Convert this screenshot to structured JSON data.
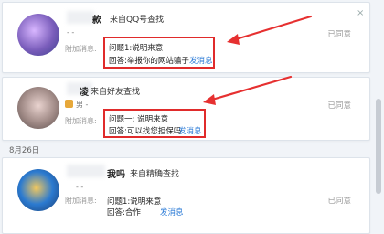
{
  "requests": [
    {
      "name_suffix": "款",
      "source": "来自QQ号查找",
      "meta_line": "- -",
      "attach_label": "附加消息:",
      "question": "问题1:说明来意",
      "answer": "回答:举报你的网站骗子",
      "reply_link": "发消息",
      "status": "已同意"
    },
    {
      "name_suffix": "凌",
      "source": "来自好友查找",
      "meta_line": "男 -",
      "attach_label": "附加消息:",
      "question": "问题一: 说明来意",
      "answer": "回答:可以找您担保吗",
      "reply_link": "发消息",
      "status": "已同意"
    },
    {
      "name_suffix": "我吗",
      "source": "来自精确查找",
      "meta_line": "- -",
      "attach_label": "附加消息:",
      "question": "问题1:说明来意",
      "answer": "回答:合作",
      "reply_link": "发消息",
      "status": "已同意"
    }
  ],
  "date_separator": "8月26日",
  "close_glyph": "×",
  "colors": {
    "highlight_red": "#e02b2b",
    "link_blue": "#2a7ad6",
    "arrow_red": "#e63030"
  },
  "icons": [
    "close-icon",
    "gender-icon",
    "arrow-annotation"
  ]
}
